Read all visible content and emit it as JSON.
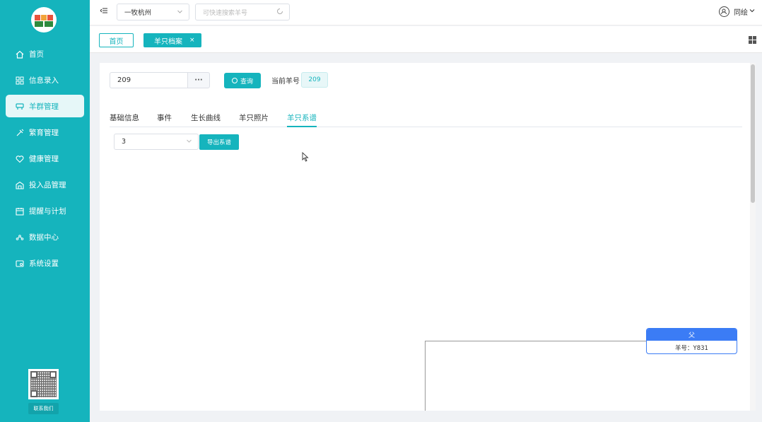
{
  "sidebar": {
    "items": [
      {
        "label": "首页",
        "icon": "home-icon"
      },
      {
        "label": "信息录入",
        "icon": "grid-icon"
      },
      {
        "label": "羊群管理",
        "icon": "sheep-icon",
        "active": true
      },
      {
        "label": "繁育管理",
        "icon": "syringe-icon"
      },
      {
        "label": "健康管理",
        "icon": "heart-icon"
      },
      {
        "label": "投入品管理",
        "icon": "warehouse-icon"
      },
      {
        "label": "提醒与计划",
        "icon": "calendar-icon"
      },
      {
        "label": "数据中心",
        "icon": "chart-icon"
      },
      {
        "label": "系统设置",
        "icon": "settings-icon"
      }
    ],
    "contact_label": "联系我们"
  },
  "topbar": {
    "farm_select": "一牧杭州",
    "quick_search_placeholder": "可快速搜索羊号",
    "user_name": "同绘"
  },
  "tabbar": {
    "home_label": "首页",
    "active_label": "羊只档案",
    "close_glyph": "×"
  },
  "main": {
    "sheep_id_input": "209",
    "more_button": "···",
    "query_button": "查询",
    "current_label": "当前羊号",
    "current_value": "209",
    "tabs": [
      {
        "label": "基础信息"
      },
      {
        "label": "事件"
      },
      {
        "label": "生长曲线"
      },
      {
        "label": "羊只照片"
      },
      {
        "label": "羊只系谱",
        "active": true
      }
    ],
    "generation_select": "3",
    "export_button": "导出系谱",
    "pedigree": {
      "node_title": "父",
      "node_label": "羊号：Y831"
    }
  },
  "colors": {
    "accent": "#15b4bd",
    "node_blue": "#3b7cf5"
  }
}
